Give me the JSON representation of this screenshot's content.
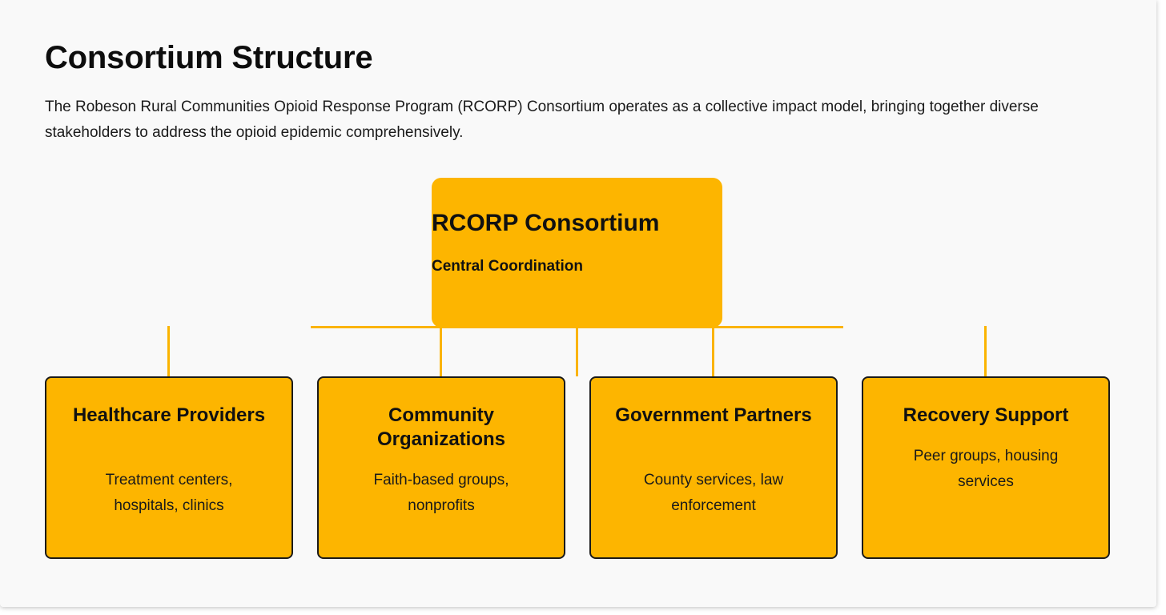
{
  "page": {
    "title": "Consortium Structure",
    "intro": "The Robeson Rural Communities Opioid Response Program (RCORP) Consortium operates as a collective impact model, bringing together diverse stakeholders to address the opioid epidemic comprehensively."
  },
  "diagram": {
    "central": {
      "title": "RCORP Consortium",
      "subtitle": "Central Coordination"
    },
    "nodes": [
      {
        "title": "Healthcare Providers",
        "description": "Treatment centers, hospitals, clinics"
      },
      {
        "title": "Community Organizations",
        "description": "Faith-based groups, nonprofits"
      },
      {
        "title": "Government Partners",
        "description": "County services, law enforcement"
      },
      {
        "title": "Recovery Support",
        "description": "Peer groups, housing services"
      }
    ],
    "colors": {
      "box_fill": "#fdb500",
      "connector": "#fbb400",
      "border": "#1a1a1a",
      "background": "#f9f9f9"
    }
  }
}
